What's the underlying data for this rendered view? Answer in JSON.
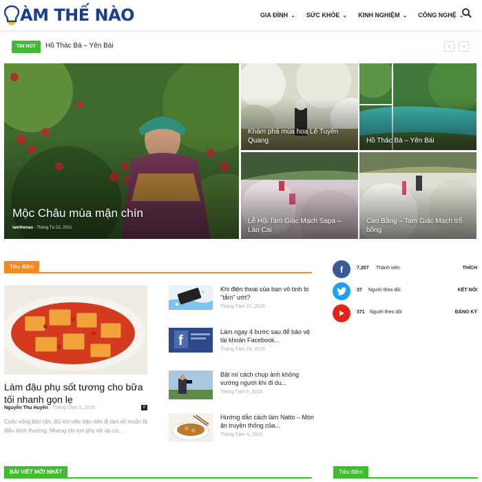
{
  "header": {
    "logo": "ÀM THẾ NÀO",
    "nav": [
      {
        "label": "GIA ĐÌNH"
      },
      {
        "label": "SỨC KHỎE"
      },
      {
        "label": "KINH NGHIỆM"
      },
      {
        "label": "CÔNG NGHỆ"
      }
    ]
  },
  "ticker": {
    "badge": "TIN HOT",
    "text": "Hồ Thác Bà – Yên Bái"
  },
  "hero": {
    "main": {
      "title": "Mộc Châu mùa mận chín",
      "author": "lamthenao",
      "date": "Tháng Tư 22, 2021"
    },
    "tiles": [
      {
        "title": "Khám phá mùa hoa Lê Tuyên Quang"
      },
      {
        "title": "Hồ Thác Bà – Yên Bái"
      },
      {
        "title": "Lễ Hội Tam Giác Mạch Sapa – Lào Cai"
      },
      {
        "title": "Cao Bằng – Tam Giác Mạch trổ bông"
      }
    ]
  },
  "focus": {
    "label": "Tiêu điểm",
    "featured": {
      "title": "Làm đậu phụ sốt tương cho bữa tối nhanh gọn lẹ",
      "author": "Nguyễn Thu Huyền",
      "date": "Tháng Chín 5, 2016",
      "comments": "0",
      "excerpt": "Cuộc sống bận rộn, đôi khi việc bận nên đi làm về muộn là điều bình thường. Nhưng chị em phụ nữ dù có..."
    },
    "list": [
      {
        "title": "Khi điện thoại của bạn vô tình bị \"tắm\" ướt?",
        "date": "Tháng Tám 27, 2016"
      },
      {
        "title": "Làm ngay 4 bước sau để bảo vệ tài khoản Facebook...",
        "date": "Tháng Tám 24, 2016"
      },
      {
        "title": "Bật mí cách chụp ảnh không vướng người khi đi du...",
        "date": "Tháng Tám 5, 2016"
      },
      {
        "title": "Hướng dẫn cách làm Natto – Món ăn truyền thống của...",
        "date": "Tháng Tám 4, 2016"
      }
    ]
  },
  "social": [
    {
      "count": "7,207",
      "label": "Thành viên",
      "action": "THÍCH",
      "color": "#3b5998"
    },
    {
      "count": "37",
      "label": "Người theo dõi",
      "action": "KẾT NỐI",
      "color": "#1da1f2"
    },
    {
      "count": "371",
      "label": "Người theo dõi",
      "action": "ĐĂNG KÝ",
      "color": "#e62117"
    }
  ],
  "bottom": {
    "latest": "BÀI VIẾT MỚI NHẤT",
    "focus": "Tiêu điểm"
  },
  "colors": {
    "accent_orange": "#f08a24",
    "accent_green": "#3dbd2f",
    "brand_blue": "#1b3f8f"
  }
}
